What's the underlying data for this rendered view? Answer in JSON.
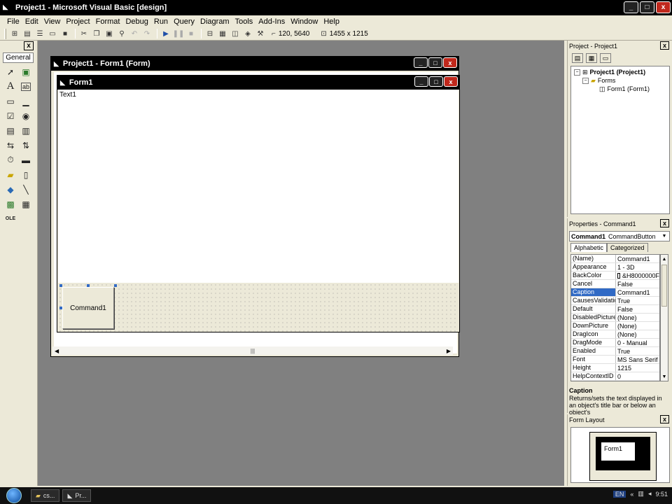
{
  "window": {
    "title": "Project1 - Microsoft Visual Basic [design]",
    "controls": {
      "minimize": "_",
      "maximize": "□",
      "close": "x"
    }
  },
  "menu": [
    "File",
    "Edit",
    "View",
    "Project",
    "Format",
    "Debug",
    "Run",
    "Query",
    "Diagram",
    "Tools",
    "Add-Ins",
    "Window",
    "Help"
  ],
  "toolbar": {
    "position": "120, 5640",
    "size": "1455 x 1215"
  },
  "toolbox": {
    "close": "x",
    "tab": "General"
  },
  "designer": {
    "title": "Project1 - Form1 (Form)",
    "form": {
      "title": "Form1",
      "textbox_text": "Text1",
      "command_caption": "Command1"
    }
  },
  "project_explorer": {
    "title": "Project - Project1",
    "close": "x",
    "tree": {
      "root": "Project1 (Project1)",
      "folder": "Forms",
      "item": "Form1 (Form1)"
    }
  },
  "properties": {
    "title": "Properties - Command1",
    "close": "x",
    "object_name": "Command1",
    "object_type": "CommandButton",
    "tabs": [
      "Alphabetic",
      "Categorized"
    ],
    "rows": [
      {
        "name": "(Name)",
        "value": "Command1"
      },
      {
        "name": "Appearance",
        "value": "1 - 3D"
      },
      {
        "name": "BackColor",
        "value": "&H8000000F"
      },
      {
        "name": "Cancel",
        "value": "False"
      },
      {
        "name": "Caption",
        "value": "Command1"
      },
      {
        "name": "CausesValidation",
        "value": "True"
      },
      {
        "name": "Default",
        "value": "False"
      },
      {
        "name": "DisabledPicture",
        "value": "(None)"
      },
      {
        "name": "DownPicture",
        "value": "(None)"
      },
      {
        "name": "DragIcon",
        "value": "(None)"
      },
      {
        "name": "DragMode",
        "value": "0 - Manual"
      },
      {
        "name": "Enabled",
        "value": "True"
      },
      {
        "name": "Font",
        "value": "MS Sans Serif"
      },
      {
        "name": "Height",
        "value": "1215"
      },
      {
        "name": "HelpContextID",
        "value": "0"
      }
    ],
    "description_title": "Caption",
    "description_text": "Returns/sets the text displayed in an object's title bar or below an object's"
  },
  "form_layout": {
    "title": "Form Layout",
    "close": "x",
    "mini_form": "Form1"
  },
  "taskbar": {
    "tasks": [
      "cs...",
      "Pr..."
    ],
    "lang": "EN",
    "clock": "9:51"
  },
  "colors": {
    "chrome": "#ece9d8",
    "mdi_background": "#808080",
    "titlebar": "#000000",
    "selection": "#316ac5",
    "close_button": "#c0281c"
  }
}
